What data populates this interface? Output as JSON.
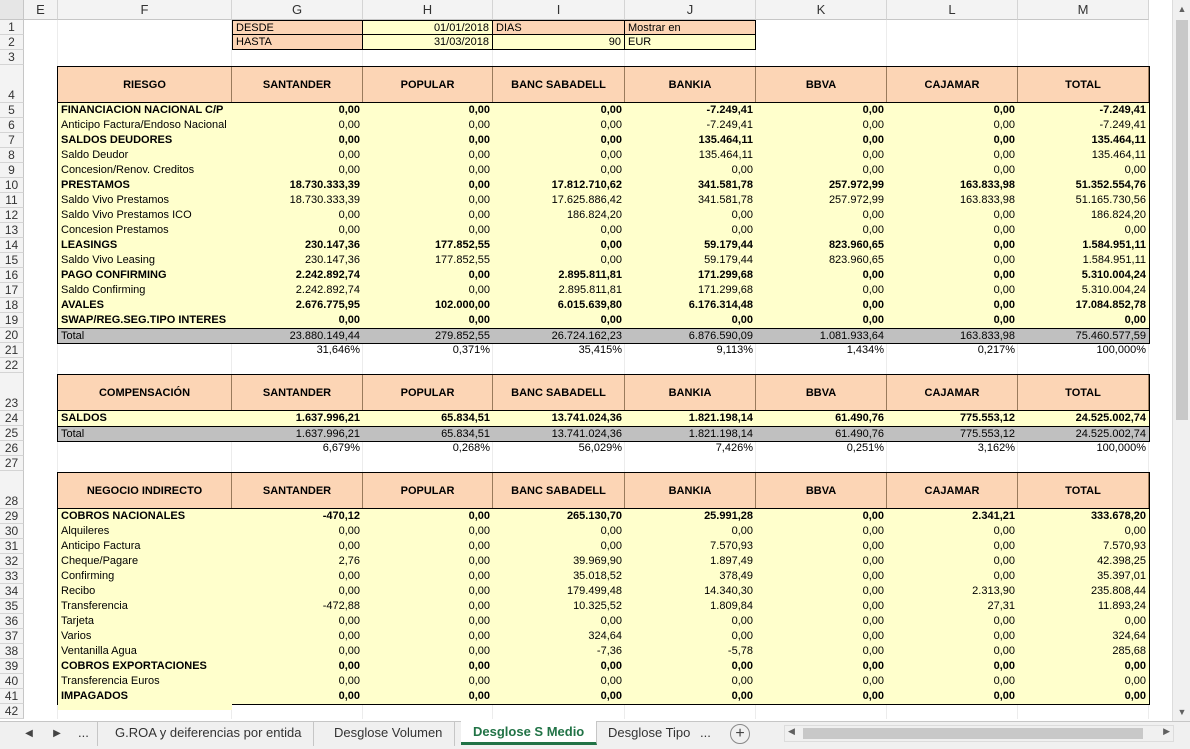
{
  "columns": [
    "E",
    "F",
    "G",
    "H",
    "I",
    "J",
    "K",
    "L",
    "M"
  ],
  "params": {
    "desde_label": "DESDE",
    "desde_value": "01/01/2018",
    "dias_label": "DIAS",
    "mostrar_label": "Mostrar en",
    "hasta_label": "HASTA",
    "hasta_value": "31/03/2018",
    "dias_value": "90",
    "mostrar_value": "EUR"
  },
  "banks": [
    "SANTANDER",
    "POPULAR",
    "BANC SABADELL",
    "BANKIA",
    "BBVA",
    "CAJAMAR",
    "TOTAL"
  ],
  "riesgo": {
    "header": "RIESGO",
    "rows": [
      {
        "label": "FINANCIACION NACIONAL C/P",
        "bold": true,
        "values": [
          "0,00",
          "0,00",
          "0,00",
          "-7.249,41",
          "0,00",
          "0,00",
          "-7.249,41"
        ]
      },
      {
        "label": "Anticipo Factura/Endoso Nacional",
        "bold": false,
        "values": [
          "0,00",
          "0,00",
          "0,00",
          "-7.249,41",
          "0,00",
          "0,00",
          "-7.249,41"
        ]
      },
      {
        "label": "SALDOS DEUDORES",
        "bold": true,
        "values": [
          "0,00",
          "0,00",
          "0,00",
          "135.464,11",
          "0,00",
          "0,00",
          "135.464,11"
        ]
      },
      {
        "label": "Saldo Deudor",
        "bold": false,
        "values": [
          "0,00",
          "0,00",
          "0,00",
          "135.464,11",
          "0,00",
          "0,00",
          "135.464,11"
        ]
      },
      {
        "label": "Concesion/Renov. Creditos",
        "bold": false,
        "values": [
          "0,00",
          "0,00",
          "0,00",
          "0,00",
          "0,00",
          "0,00",
          "0,00"
        ]
      },
      {
        "label": "PRESTAMOS",
        "bold": true,
        "values": [
          "18.730.333,39",
          "0,00",
          "17.812.710,62",
          "341.581,78",
          "257.972,99",
          "163.833,98",
          "51.352.554,76"
        ]
      },
      {
        "label": "Saldo Vivo Prestamos",
        "bold": false,
        "values": [
          "18.730.333,39",
          "0,00",
          "17.625.886,42",
          "341.581,78",
          "257.972,99",
          "163.833,98",
          "51.165.730,56"
        ]
      },
      {
        "label": "Saldo Vivo Prestamos ICO",
        "bold": false,
        "values": [
          "0,00",
          "0,00",
          "186.824,20",
          "0,00",
          "0,00",
          "0,00",
          "186.824,20"
        ]
      },
      {
        "label": "Concesion Prestamos",
        "bold": false,
        "values": [
          "0,00",
          "0,00",
          "0,00",
          "0,00",
          "0,00",
          "0,00",
          "0,00"
        ]
      },
      {
        "label": "LEASINGS",
        "bold": true,
        "values": [
          "230.147,36",
          "177.852,55",
          "0,00",
          "59.179,44",
          "823.960,65",
          "0,00",
          "1.584.951,11"
        ]
      },
      {
        "label": "Saldo Vivo Leasing",
        "bold": false,
        "values": [
          "230.147,36",
          "177.852,55",
          "0,00",
          "59.179,44",
          "823.960,65",
          "0,00",
          "1.584.951,11"
        ]
      },
      {
        "label": "PAGO CONFIRMING",
        "bold": true,
        "values": [
          "2.242.892,74",
          "0,00",
          "2.895.811,81",
          "171.299,68",
          "0,00",
          "0,00",
          "5.310.004,24"
        ]
      },
      {
        "label": "Saldo Confirming",
        "bold": false,
        "values": [
          "2.242.892,74",
          "0,00",
          "2.895.811,81",
          "171.299,68",
          "0,00",
          "0,00",
          "5.310.004,24"
        ]
      },
      {
        "label": "AVALES",
        "bold": true,
        "values": [
          "2.676.775,95",
          "102.000,00",
          "6.015.639,80",
          "6.176.314,48",
          "0,00",
          "0,00",
          "17.084.852,78"
        ]
      },
      {
        "label": "SWAP/REG.SEG.TIPO INTERES",
        "bold": true,
        "values": [
          "0,00",
          "0,00",
          "0,00",
          "0,00",
          "0,00",
          "0,00",
          "0,00"
        ]
      }
    ],
    "total": {
      "label": "Total",
      "values": [
        "23.880.149,44",
        "279.852,55",
        "26.724.162,23",
        "6.876.590,09",
        "1.081.933,64",
        "163.833,98",
        "75.460.577,59"
      ]
    },
    "pct": [
      "31,646%",
      "0,371%",
      "35,415%",
      "9,113%",
      "1,434%",
      "0,217%",
      "100,000%"
    ]
  },
  "compensacion": {
    "header": "COMPENSACIÓN",
    "rows": [
      {
        "label": "SALDOS",
        "bold": true,
        "values": [
          "1.637.996,21",
          "65.834,51",
          "13.741.024,36",
          "1.821.198,14",
          "61.490,76",
          "775.553,12",
          "24.525.002,74"
        ]
      }
    ],
    "total": {
      "label": "Total",
      "values": [
        "1.637.996,21",
        "65.834,51",
        "13.741.024,36",
        "1.821.198,14",
        "61.490,76",
        "775.553,12",
        "24.525.002,74"
      ]
    },
    "pct": [
      "6,679%",
      "0,268%",
      "56,029%",
      "7,426%",
      "0,251%",
      "3,162%",
      "100,000%"
    ]
  },
  "negocio": {
    "header": "NEGOCIO INDIRECTO",
    "rows": [
      {
        "label": "COBROS NACIONALES",
        "bold": true,
        "values": [
          "-470,12",
          "0,00",
          "265.130,70",
          "25.991,28",
          "0,00",
          "2.341,21",
          "333.678,20"
        ]
      },
      {
        "label": "Alquileres",
        "bold": false,
        "values": [
          "0,00",
          "0,00",
          "0,00",
          "0,00",
          "0,00",
          "0,00",
          "0,00"
        ]
      },
      {
        "label": "Anticipo Factura",
        "bold": false,
        "values": [
          "0,00",
          "0,00",
          "0,00",
          "7.570,93",
          "0,00",
          "0,00",
          "7.570,93"
        ]
      },
      {
        "label": "Cheque/Pagare",
        "bold": false,
        "values": [
          "2,76",
          "0,00",
          "39.969,90",
          "1.897,49",
          "0,00",
          "0,00",
          "42.398,25"
        ]
      },
      {
        "label": "Confirming",
        "bold": false,
        "values": [
          "0,00",
          "0,00",
          "35.018,52",
          "378,49",
          "0,00",
          "0,00",
          "35.397,01"
        ]
      },
      {
        "label": "Recibo",
        "bold": false,
        "values": [
          "0,00",
          "0,00",
          "179.499,48",
          "14.340,30",
          "0,00",
          "2.313,90",
          "235.808,44"
        ]
      },
      {
        "label": "Transferencia",
        "bold": false,
        "values": [
          "-472,88",
          "0,00",
          "10.325,52",
          "1.809,84",
          "0,00",
          "27,31",
          "11.893,24"
        ]
      },
      {
        "label": "Tarjeta",
        "bold": false,
        "values": [
          "0,00",
          "0,00",
          "0,00",
          "0,00",
          "0,00",
          "0,00",
          "0,00"
        ]
      },
      {
        "label": "Varios",
        "bold": false,
        "values": [
          "0,00",
          "0,00",
          "324,64",
          "0,00",
          "0,00",
          "0,00",
          "324,64"
        ]
      },
      {
        "label": "Ventanilla Agua",
        "bold": false,
        "values": [
          "0,00",
          "0,00",
          "-7,36",
          "-5,78",
          "0,00",
          "0,00",
          "285,68"
        ]
      },
      {
        "label": "COBROS EXPORTACIONES",
        "bold": true,
        "values": [
          "0,00",
          "0,00",
          "0,00",
          "0,00",
          "0,00",
          "0,00",
          "0,00"
        ]
      },
      {
        "label": "Transferencia Euros",
        "bold": false,
        "values": [
          "0,00",
          "0,00",
          "0,00",
          "0,00",
          "0,00",
          "0,00",
          "0,00"
        ]
      },
      {
        "label": "IMPAGADOS",
        "bold": true,
        "values": [
          "0,00",
          "0,00",
          "0,00",
          "0,00",
          "0,00",
          "0,00",
          "0,00"
        ]
      }
    ]
  },
  "tabs": {
    "more_left": "...",
    "items": [
      "G.ROA y deiferencias por entida",
      "Desglose Volumen",
      "Desglose S Medio",
      "Desglose Tipo"
    ],
    "active_index": 2,
    "more_right": "...",
    "add": "+"
  }
}
